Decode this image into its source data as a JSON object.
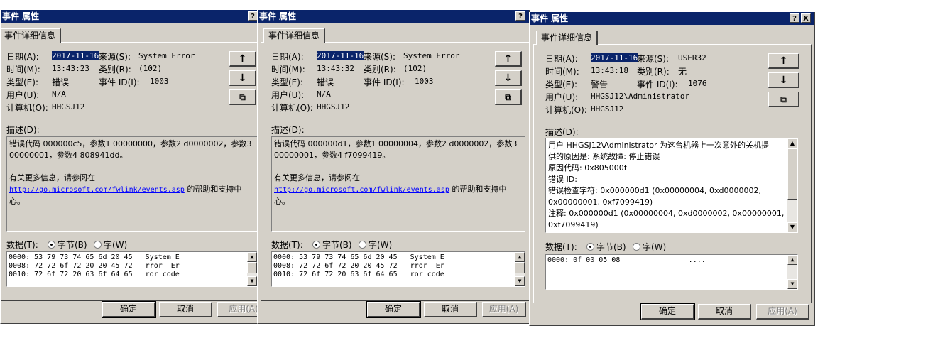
{
  "labels": {
    "title": "事件 属性",
    "tab": "事件详细信息",
    "date": "日期(A):",
    "time": "时间(M):",
    "type": "类型(E):",
    "user": "用户(U):",
    "computer": "计算机(O):",
    "source": "来源(S):",
    "category": "类别(R):",
    "event_id": "事件 ID(I):",
    "description": "描述(D):",
    "data": "数据(T):",
    "bytes": "字节(B)",
    "words": "字(W)",
    "ok": "确定",
    "cancel": "取消",
    "apply": "应用(A)",
    "help_icon": "?",
    "close_icon": "X",
    "up_icon": "↑",
    "down_icon": "↓",
    "copy_icon": "⧉"
  },
  "dialogs": [
    {
      "date": "2017-11-16",
      "time": "13:43:23",
      "type": "错误",
      "user": "N/A",
      "computer": "HHGSJ12",
      "source": "System Error",
      "category": "(102)",
      "event_id": "1003",
      "description_lines": [
        "错误代码 000000c5，参数1 00000000，参数2 d0000002，参数3",
        "00000001，参数4 808941dd。",
        "",
        "有关更多信息，请参阅在"
      ],
      "link": "http://go.microsoft.com/fwlink/events.asp",
      "link_suffix": " 的帮助和支持中",
      "link_suffix2": "心。",
      "data_lines": [
        "0000: 53 79 73 74 65 6d 20 45   System E",
        "0008: 72 72 6f 72 20 20 45 72   rror  Er",
        "0010: 72 6f 72 20 63 6f 64 65   ror code"
      ]
    },
    {
      "date": "2017-11-16",
      "time": "13:43:32",
      "type": "错误",
      "user": "N/A",
      "computer": "HHGSJ12",
      "source": "System Error",
      "category": "(102)",
      "event_id": "1003",
      "description_lines": [
        "错误代码 000000d1，参数1 00000004，参数2 d0000002，参数3",
        "00000001，参数4 f7099419。",
        "",
        "有关更多信息，请参阅在"
      ],
      "link": "http://go.microsoft.com/fwlink/events.asp",
      "link_suffix": " 的帮助和支持中",
      "link_suffix2": "心。",
      "data_lines": [
        "0000: 53 79 73 74 65 6d 20 45   System E",
        "0008: 72 72 6f 72 20 20 45 72   rror  Er",
        "0010: 72 6f 72 20 63 6f 64 65   ror code"
      ]
    },
    {
      "date": "2017-11-16",
      "time": "13:43:18",
      "type": "警告",
      "user": "HHGSJ12\\Administrator",
      "computer": "HHGSJ12",
      "source": "USER32",
      "category": "无",
      "event_id": "1076",
      "description_lines": [
        "用户 HHGSJ12\\Administrator 为这台机器上一次意外的关机提",
        "供的原因是: 系统故障: 停止错误",
        " 原因代码: 0x805000f",
        " 错误 ID:",
        " 错误检查字符: 0x000000d1 (0x00000004, 0xd0000002,",
        "0x00000001, 0xf7099419)",
        " 注释: 0x000000d1 (0x00000004, 0xd0000002, 0x00000001,",
        "0xf7099419)"
      ],
      "data_lines": [
        "0000: 0f 00 05 08                ...."
      ]
    }
  ]
}
